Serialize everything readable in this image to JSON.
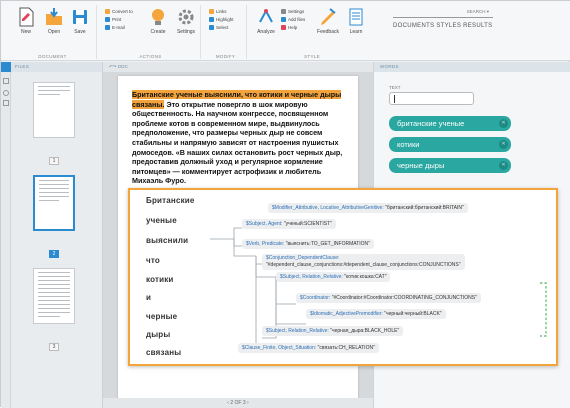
{
  "ribbon": {
    "document": {
      "group_label": "DOCUMENT",
      "new": "New",
      "open": "Open",
      "save": "Save"
    },
    "actions": {
      "group_label": "ACTIONS",
      "convert": "Convert to",
      "print": "Print",
      "email": "E-mail",
      "create": "Create",
      "settings": "Settings"
    },
    "modify": {
      "group_label": "MODIFY",
      "links": "Links",
      "highlight": "Highlight",
      "select": "Select"
    },
    "style": {
      "group_label": "STYLE",
      "analyze": "Analyze",
      "s_settings": "Settings",
      "add_files": "Add files",
      "help": "Help",
      "feedback": "Feedback",
      "learn": "Learn"
    },
    "search_placeholder": "SEARCH",
    "top_tabs": "DOCUMENTS  STYLES  RESULTS"
  },
  "left_panel": {
    "header": "FILES",
    "pages": [
      "1",
      "2",
      "3"
    ]
  },
  "doc": {
    "header": "DOC",
    "highlight_text": "Британские ученые выяснили, что котики и черные дыры связаны.",
    "body_text": " Это открытие повергло в шок мировую общественность. На научном конгрессе, посвященном проблеме котов в современном мире, выдвинулось предположение, что размеры черных дыр не совсем стабильны и напрямую зависят от настроения пушистых домоседов. «В наших силах остановить рост черных дыр, предоставив должный уход и регулярное кормление питомцев» — комментирует астрофизик и любитель Михаэль Фуро.",
    "page_indicator": "2 OF 3"
  },
  "right_panel": {
    "header": "WORDS",
    "input_label": "TEXT",
    "input_value": "",
    "tags": [
      "британские ученые",
      "котики",
      "черные дыры"
    ]
  },
  "popup": {
    "words": [
      "Британские",
      "ученые",
      "выяснили",
      "что",
      "котики",
      "и",
      "черные",
      "дыры",
      "связаны"
    ],
    "nodes": [
      {
        "a": "$Modifier_Attributive, Locative_AttributiveGenitive:",
        "b": "\"британский:британский:BRITAIN\""
      },
      {
        "a": "$Subject, Agent:",
        "b": "\"ученый:SCIENTIST\""
      },
      {
        "a": "$Verb, Predicate:",
        "b": "\"выяснить:TO_GET_INFORMATION\""
      },
      {
        "a": "$Conjunction_DependentClause:",
        "b": "\"#dependent_clause_conjunctions:#dependent_clause_conjunctions:CONJUNCTIONS\""
      },
      {
        "a": "$Subject, Relation_Relative:",
        "b": "\"котик:кошка:CAT\""
      },
      {
        "a": "$Coordinator:",
        "b": "\"#Coordinator:#Coordinator:COORDINATING_CONJUNCTIONS\""
      },
      {
        "a": "$Idiomatic_AdjectivePremodifier:",
        "b": "\"черный:черный:BLACK\""
      },
      {
        "a": "$Subject, Relation_Relative:",
        "b": "\"черная_дыра:BLACK_HOLE\""
      },
      {
        "a": "$Clause_Finite, Object_Situation:",
        "b": "\"связать:CH_RELATION\""
      }
    ]
  },
  "colors": {
    "accent": "#2b8bd1",
    "highlight": "#f3a33b",
    "tag": "#2aa7a0",
    "popup_border": "#f2a53a"
  }
}
